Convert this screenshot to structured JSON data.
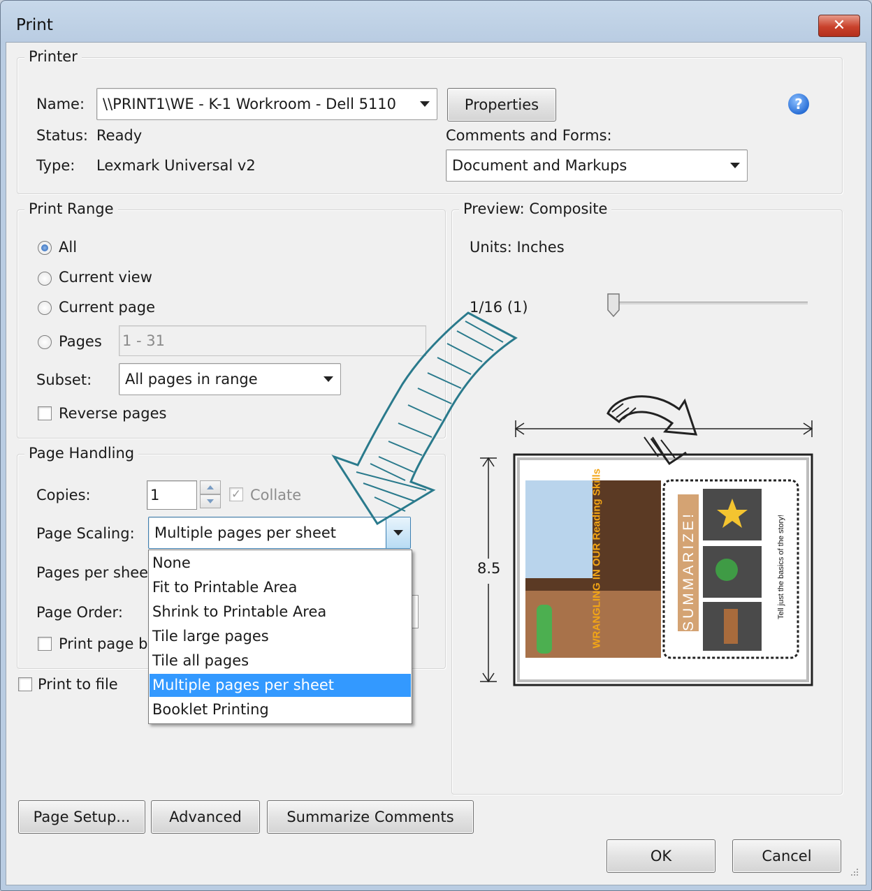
{
  "window": {
    "title": "Print",
    "close_symbol": "✕"
  },
  "printer": {
    "legend": "Printer",
    "name_label": "Name:",
    "name_value": "\\\\PRINT1\\WE - K-1 Workroom - Dell 5110",
    "properties_label": "Properties",
    "status_label": "Status:",
    "status_value": "Ready",
    "type_label": "Type:",
    "type_value": "Lexmark Universal v2",
    "comments_label": "Comments and Forms:",
    "comments_value": "Document and Markups",
    "help_symbol": "?"
  },
  "print_range": {
    "legend": "Print Range",
    "options": [
      "All",
      "Current view",
      "Current page",
      "Pages"
    ],
    "selected": "All",
    "pages_value": "1 - 31",
    "subset_label": "Subset:",
    "subset_value": "All pages in range",
    "reverse_label": "Reverse pages"
  },
  "page_handling": {
    "legend": "Page Handling",
    "copies_label": "Copies:",
    "copies_value": "1",
    "collate_label": "Collate",
    "scaling_label": "Page Scaling:",
    "scaling_value": "Multiple pages per sheet",
    "pages_per_sheet_label": "Pages per sheet",
    "page_order_label": "Page Order:",
    "print_page_border_label": "Print page b",
    "scaling_options": [
      "None",
      "Fit to Printable Area",
      "Shrink to Printable Area",
      "Tile large pages",
      "Tile all pages",
      "Multiple pages per sheet",
      "Booklet Printing"
    ],
    "scaling_selected_index": 5
  },
  "print_to_file_label": "Print to file",
  "preview": {
    "legend": "Preview: Composite",
    "units": "Units: Inches",
    "zoom": "1/16 (1)",
    "height_label": "8.5",
    "thumb_title": "WRANGLING IN OUR Reading Skills",
    "thumb_summarize": "SUMMARIZE!",
    "thumb_side_text": "Tell just the basics of the story!"
  },
  "footer": {
    "page_setup": "Page Setup...",
    "advanced": "Advanced",
    "summarize": "Summarize Comments",
    "ok": "OK",
    "cancel": "Cancel"
  },
  "colors": {
    "selection": "#3399ff",
    "annotation_arrow": "#2a7a8c",
    "close_button": "#c9412b"
  }
}
